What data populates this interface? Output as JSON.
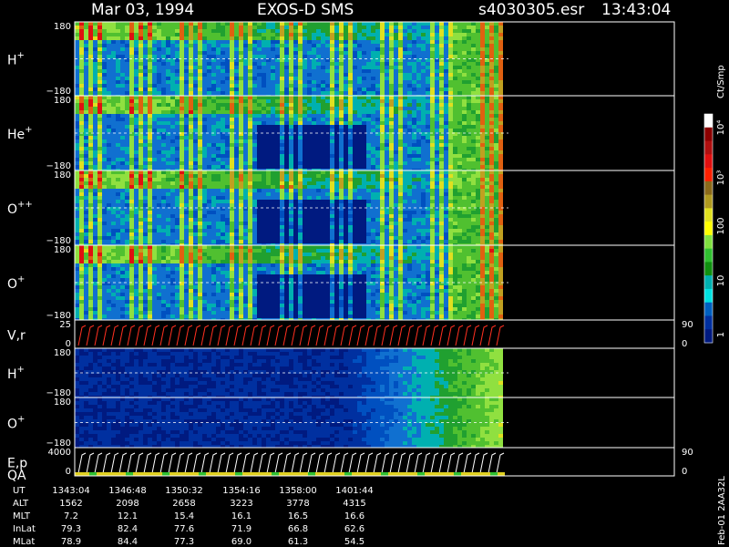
{
  "header": {
    "date": "Mar 03, 1994",
    "instrument": "EXOS-D SMS",
    "file": "s4030305.esr",
    "time": "13:43:04"
  },
  "chart_data": {
    "type": "heatmap",
    "panels": [
      {
        "label": "H",
        "sup": "+",
        "ylim": [
          -180,
          180
        ],
        "ticks": [
          "180",
          "−180"
        ]
      },
      {
        "label": "He",
        "sup": "+",
        "ylim": [
          -180,
          180
        ],
        "ticks": [
          "180",
          "−180"
        ]
      },
      {
        "label": "O",
        "sup": "++",
        "ylim": [
          -180,
          180
        ],
        "ticks": [
          "180",
          "−180"
        ]
      },
      {
        "label": "O",
        "sup": "+",
        "ylim": [
          -180,
          180
        ],
        "ticks": [
          "180",
          "−180"
        ]
      },
      {
        "label": "V,r",
        "sup": "",
        "ylim": [
          0,
          25
        ],
        "ticks": [
          "25",
          "0"
        ],
        "right_ticks": [
          "90",
          "0"
        ]
      },
      {
        "label": "H",
        "sup": "+",
        "ylim": [
          -180,
          180
        ],
        "ticks": [
          "180",
          "−180"
        ]
      },
      {
        "label": "O",
        "sup": "+",
        "ylim": [
          -180,
          180
        ],
        "ticks": [
          "180",
          "−180"
        ]
      },
      {
        "label": "E,p",
        "label2": "QA",
        "sup": "",
        "ylim": [
          0,
          4000
        ],
        "ticks": [
          "4000",
          "0"
        ],
        "right_ticks": [
          "90",
          "0"
        ]
      }
    ],
    "colorbar": {
      "units": "Ct/Smp",
      "ticks": [
        "10⁴",
        "10³",
        "100",
        "10",
        "1"
      ],
      "colors": [
        "#ffffff",
        "#8b0000",
        "#b01010",
        "#e01010",
        "#ff2000",
        "#8b6a1a",
        "#b09a20",
        "#e0e020",
        "#ffff00",
        "#80e040",
        "#30c030",
        "#109010",
        "#00b0b0",
        "#00e0e0",
        "#0060c0",
        "#0030a0",
        "#001a80"
      ]
    },
    "ephemeris": {
      "rows": [
        {
          "label": "UT",
          "values": [
            "1343:04",
            "1346:48",
            "1350:32",
            "1354:16",
            "1358:00",
            "1401:44"
          ]
        },
        {
          "label": "ALT",
          "values": [
            "1562",
            "2098",
            "2658",
            "3223",
            "3778",
            "4315"
          ]
        },
        {
          "label": "MLT",
          "values": [
            "7.2",
            "12.1",
            "15.4",
            "16.1",
            "16.5",
            "16.6"
          ]
        },
        {
          "label": "InLat",
          "values": [
            "79.3",
            "82.4",
            "77.6",
            "71.9",
            "66.8",
            "62.6"
          ]
        },
        {
          "label": "MLat",
          "values": [
            "78.9",
            "84.4",
            "77.3",
            "69.0",
            "61.3",
            "54.5"
          ]
        }
      ]
    },
    "side_label": "Feb-01 2AA32L"
  },
  "colors": {
    "background": "#000000",
    "axis": "#ffffff"
  }
}
